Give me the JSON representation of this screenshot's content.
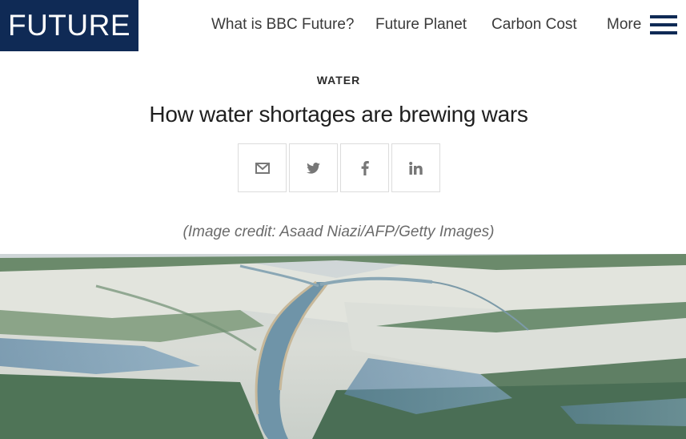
{
  "header": {
    "logo_text": "FUTURE",
    "nav": [
      "What is BBC Future?",
      "Future Planet",
      "Carbon Cost"
    ],
    "more_label": "More",
    "brand_color": "#0f2a55"
  },
  "article": {
    "section": "WATER",
    "headline": "How water shortages are brewing wars",
    "share_icons": [
      "email-icon",
      "twitter-icon",
      "facebook-icon",
      "linkedin-icon"
    ],
    "image_credit": "(Image credit: Asaad Niazi/AFP/Getty Images)"
  }
}
